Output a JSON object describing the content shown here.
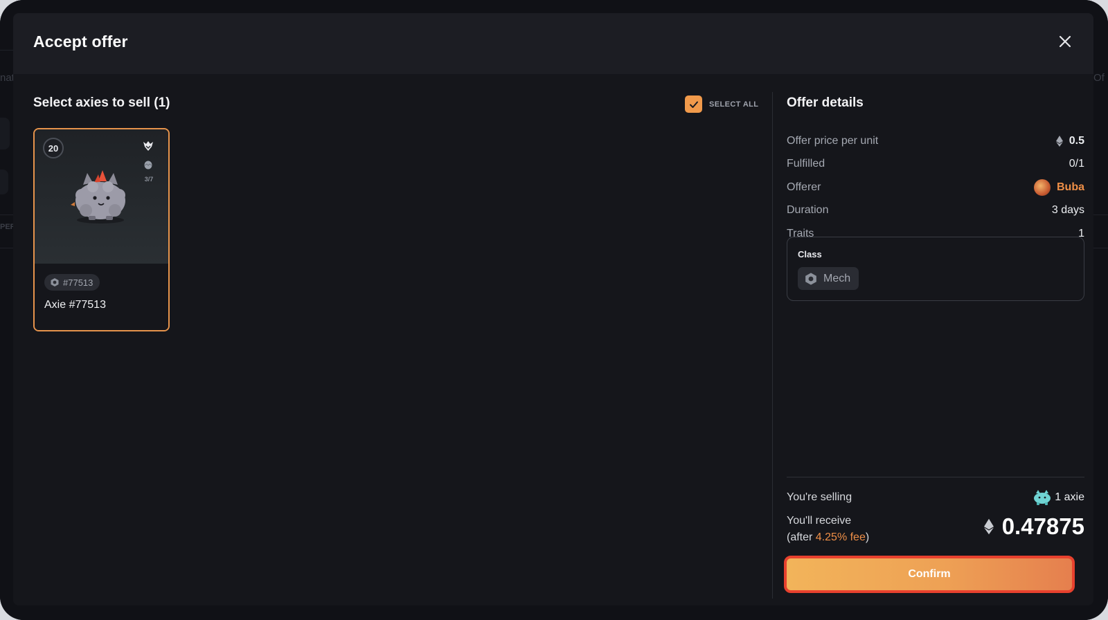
{
  "background_fragments": {
    "left_1": "nat",
    "left_2": "PER",
    "right_1": "Of"
  },
  "modal": {
    "title": "Accept offer",
    "close_icon": "close-icon"
  },
  "selection": {
    "title": "Select axies to sell (1)",
    "select_all_label": "SELECT ALL",
    "select_all_checked": true
  },
  "axie": {
    "level": "20",
    "breed_count": "3/7",
    "id_label": "#77513",
    "name": "Axie #77513",
    "class_icon": "mech-class-icon",
    "selected": true
  },
  "offer_details": {
    "title": "Offer details",
    "rows": [
      {
        "label": "Offer price per unit",
        "value": "0.5",
        "icon": "eth-icon"
      },
      {
        "label": "Fulfilled",
        "value": "0/1"
      },
      {
        "label": "Offerer",
        "value": "Buba",
        "icon": "avatar"
      },
      {
        "label": "Duration",
        "value": "3 days"
      },
      {
        "label": "Traits",
        "value": "1"
      }
    ],
    "traits": {
      "title": "Class",
      "value": "Mech"
    }
  },
  "summary": {
    "selling_label": "You're selling",
    "selling_value": "1 axie",
    "receive_label_line1": "You'll receive",
    "receive_label_prefix": "(after ",
    "receive_fee": "4.25% fee",
    "receive_label_suffix": ")",
    "receive_amount": "0.47875"
  },
  "confirm_label": "Confirm",
  "colors": {
    "accent": "#ef8f47",
    "confirm_border": "#e8412e",
    "modal_bg": "#15161b"
  }
}
